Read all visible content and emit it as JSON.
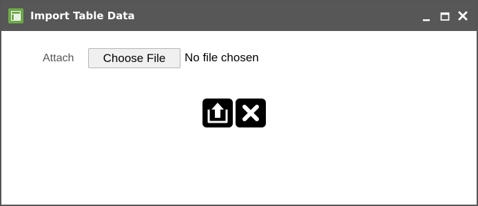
{
  "window": {
    "title": "Import Table Data",
    "app_icon": "import-table-icon",
    "controls": {
      "minimize": "minimize-icon",
      "maximize": "maximize-icon",
      "close": "close-icon"
    },
    "colors": {
      "titlebar": "#575757",
      "icon_green": "#6fa84a"
    }
  },
  "form": {
    "attach_label": "Attach",
    "choose_file_label": "Choose File",
    "file_status": "No file chosen"
  },
  "actions": {
    "upload_icon": "upload-icon",
    "cancel_icon": "cancel-x-icon"
  }
}
